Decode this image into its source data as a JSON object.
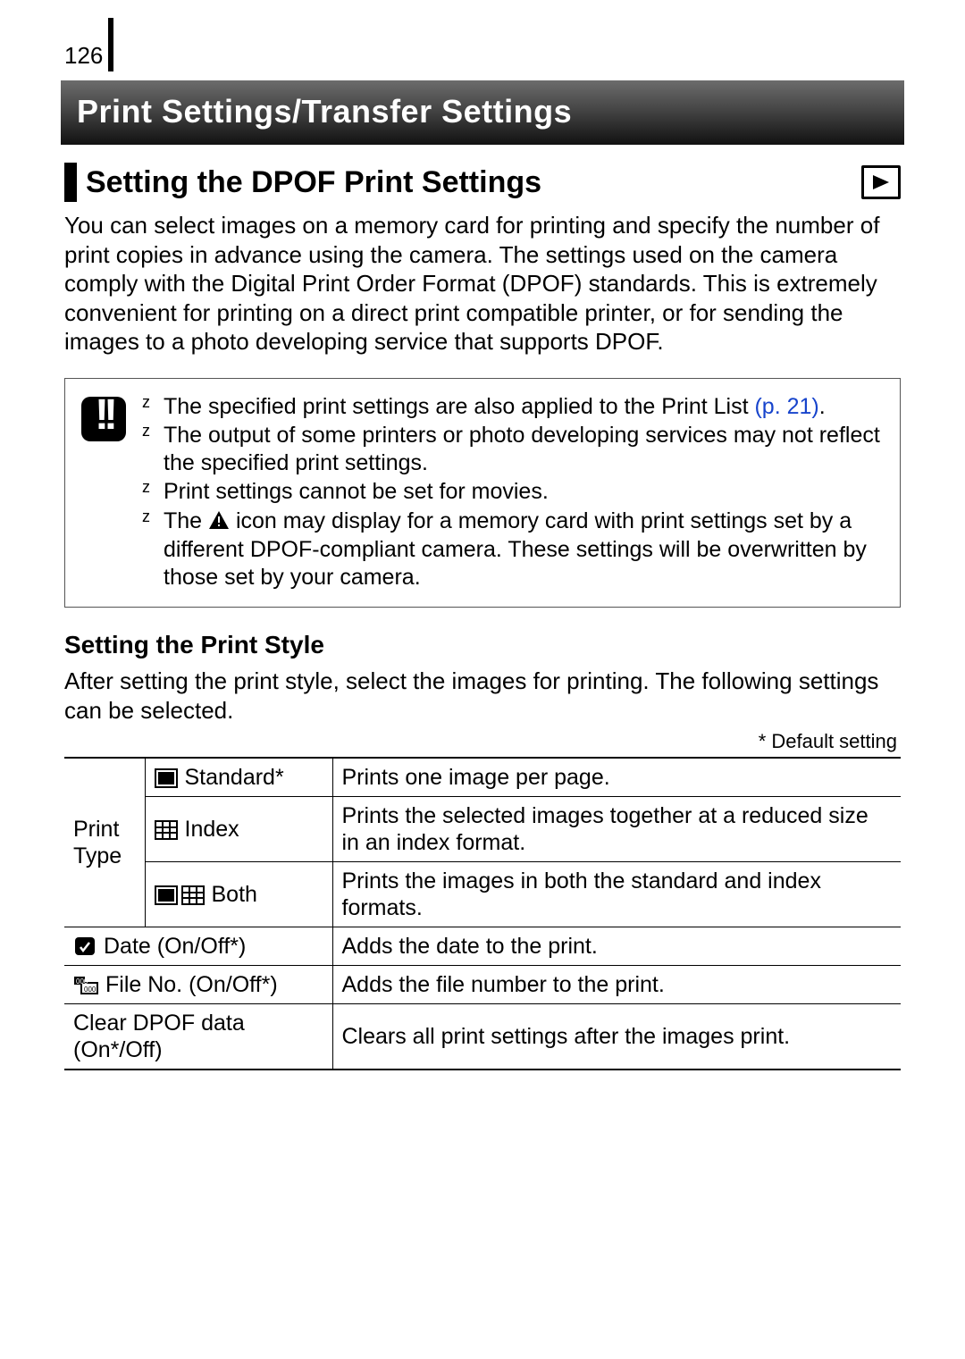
{
  "page_number": "126",
  "h1": "Print Settings/Transfer Settings",
  "h2": "Setting the DPOF Print Settings",
  "intro": "You can select images on a memory card for printing and specify the number of print copies in advance using the camera. The settings used on the camera comply with the Digital Print Order Format (DPOF) standards. This is extremely convenient for printing on a direct print compatible printer, or for sending the images to a photo developing service that supports DPOF.",
  "notes": {
    "bullet": "z",
    "items": {
      "n1_a": "The specified print settings are also applied to the Print List ",
      "n1_link": "(p. 21)",
      "n1_b": ".",
      "n2": "The output of some printers or photo developing services may not reflect the specified print settings.",
      "n3": "Print settings cannot be set for movies.",
      "n4_a": "The ",
      "n4_b": " icon may display for a memory card with print settings set by a different DPOF-compliant camera. These settings will be overwritten by those set by your camera."
    }
  },
  "h3": "Setting the Print Style",
  "style_intro": "After setting the print style, select the images for printing. The following settings can be selected.",
  "default_note": "* Default setting",
  "table": {
    "print_type_label": "Print Type",
    "rows": {
      "standard": {
        "label": "Standard*",
        "desc": "Prints one image per page."
      },
      "index": {
        "label": "Index",
        "desc": "Prints the selected images together at a reduced size in an index format."
      },
      "both": {
        "label": "Both",
        "desc": "Prints the images in both the standard and index formats."
      },
      "date": {
        "label": "Date (On/Off*)",
        "desc": "Adds the date to the print."
      },
      "fileno": {
        "label": "File No. (On/Off*)",
        "desc": "Adds the file number to the print."
      },
      "clear": {
        "label": "Clear DPOF data (On*/Off)",
        "desc": "Clears all print settings after the images print."
      }
    }
  }
}
